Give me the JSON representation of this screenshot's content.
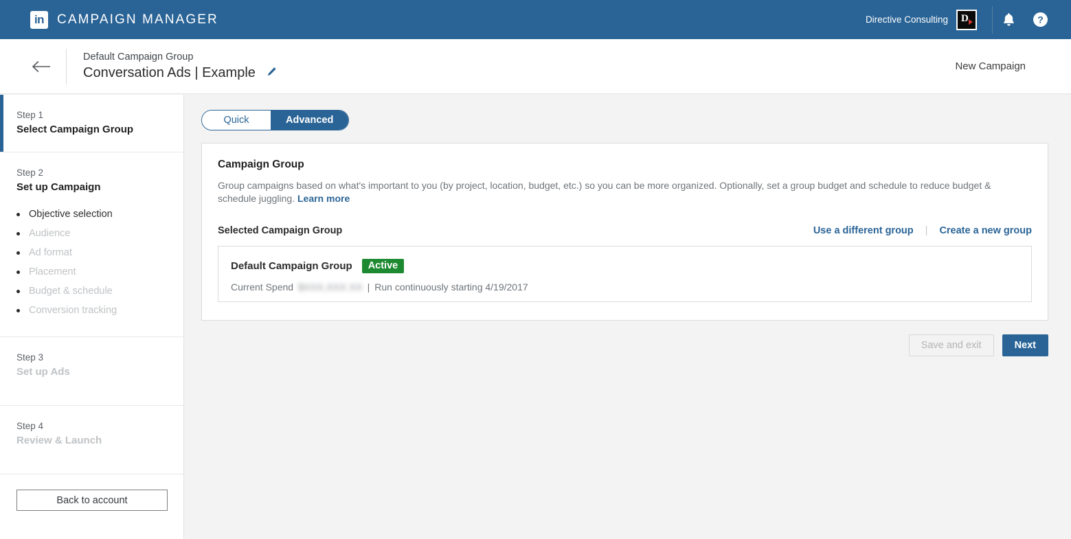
{
  "header": {
    "logo_icon": "linkedin-logo-icon",
    "logo_text": "in",
    "brand_title": "CAMPAIGN MANAGER",
    "account_name": "Directive Consulting",
    "avatar_letter": "D",
    "notifications_icon": "bell-icon",
    "help_icon": "help-circle-icon"
  },
  "subheader": {
    "back_icon": "arrow-left-icon",
    "breadcrumb_group": "Default Campaign Group",
    "campaign_name": "Conversation Ads | Example",
    "edit_icon": "pencil-edit-icon",
    "right_label": "New Campaign"
  },
  "sidebar": {
    "steps": [
      {
        "label": "Step 1",
        "title": "Select Campaign Group",
        "active": true,
        "substeps": []
      },
      {
        "label": "Step 2",
        "title": "Set up Campaign",
        "active": false,
        "substeps": [
          {
            "label": "Objective selection",
            "current": true
          },
          {
            "label": "Audience",
            "current": false
          },
          {
            "label": "Ad format",
            "current": false
          },
          {
            "label": "Placement",
            "current": false
          },
          {
            "label": "Budget & schedule",
            "current": false
          },
          {
            "label": "Conversion tracking",
            "current": false
          }
        ]
      },
      {
        "label": "Step 3",
        "title": "Set up Ads",
        "active": false,
        "substeps": []
      },
      {
        "label": "Step 4",
        "title": "Review & Launch",
        "active": false,
        "substeps": []
      }
    ],
    "back_to_account": "Back to account"
  },
  "main": {
    "toggle": {
      "quick": "Quick",
      "advanced": "Advanced",
      "selected": "Advanced"
    },
    "card": {
      "title": "Campaign Group",
      "description": "Group campaigns based on what's important to you (by project, location, budget, etc.) so you can be more organized. Optionally, set a group budget and schedule to reduce budget & schedule juggling.",
      "learn_more": "Learn more",
      "selected_label": "Selected Campaign Group",
      "use_different_group": "Use a different group",
      "link_separator": "|",
      "create_new_group": "Create a new group",
      "group": {
        "name": "Default Campaign Group",
        "status": "Active",
        "status_color": "#1d8a31",
        "spend_label": "Current Spend",
        "spend_value": "$XXX,XXX.XX",
        "meta_separator": "|",
        "schedule": "Run continuously starting 4/19/2017"
      }
    },
    "actions": {
      "save_and_exit": "Save and exit",
      "next": "Next"
    }
  }
}
